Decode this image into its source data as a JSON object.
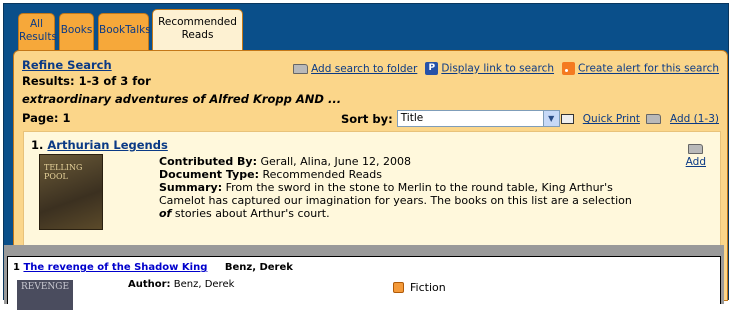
{
  "tabs": [
    {
      "label_line1": "All",
      "label_line2": "Results"
    },
    {
      "label": "Books"
    },
    {
      "label": "BookTalks"
    },
    {
      "label_line1": "Recommended",
      "label_line2": "Reads"
    }
  ],
  "refine": "Refine Search",
  "results": "Results: 1-3 of 3 for",
  "query": "extraordinary adventures of Alfred Kropp AND ...",
  "page": "Page: 1",
  "toplinks": {
    "add_search": "Add search to folder",
    "display_link": "Display link to search",
    "create_alert": "Create alert for this search"
  },
  "sort": {
    "label": "Sort by:",
    "value": "Title"
  },
  "print": {
    "quick_print": "Quick Print",
    "add": "Add (1-3)"
  },
  "item": {
    "number": "1.",
    "title": "Arthurian Legends",
    "cover_text": "TELLING POOL",
    "contributed_label": "Contributed By:",
    "contributed_value": "Gerall, Alina, June 12, 2008",
    "doctype_label": "Document Type:",
    "doctype_value": "Recommended Reads",
    "summary_label": "Summary:",
    "summary_pre": "From the sword in the stone to Merlin to the round table, King Arthur's Camelot has captured our imagination for years. The books on this list are a selection",
    "summary_em": "of",
    "summary_post": "stories about Arthur's court.",
    "add": "Add"
  },
  "overlay": {
    "number": "1",
    "title": "The revenge of the Shadow King",
    "author_head": "Benz, Derek",
    "cover_text": "REVENGE",
    "author_label": "Author:",
    "author_value": "Benz, Derek",
    "fiction": "Fiction"
  }
}
